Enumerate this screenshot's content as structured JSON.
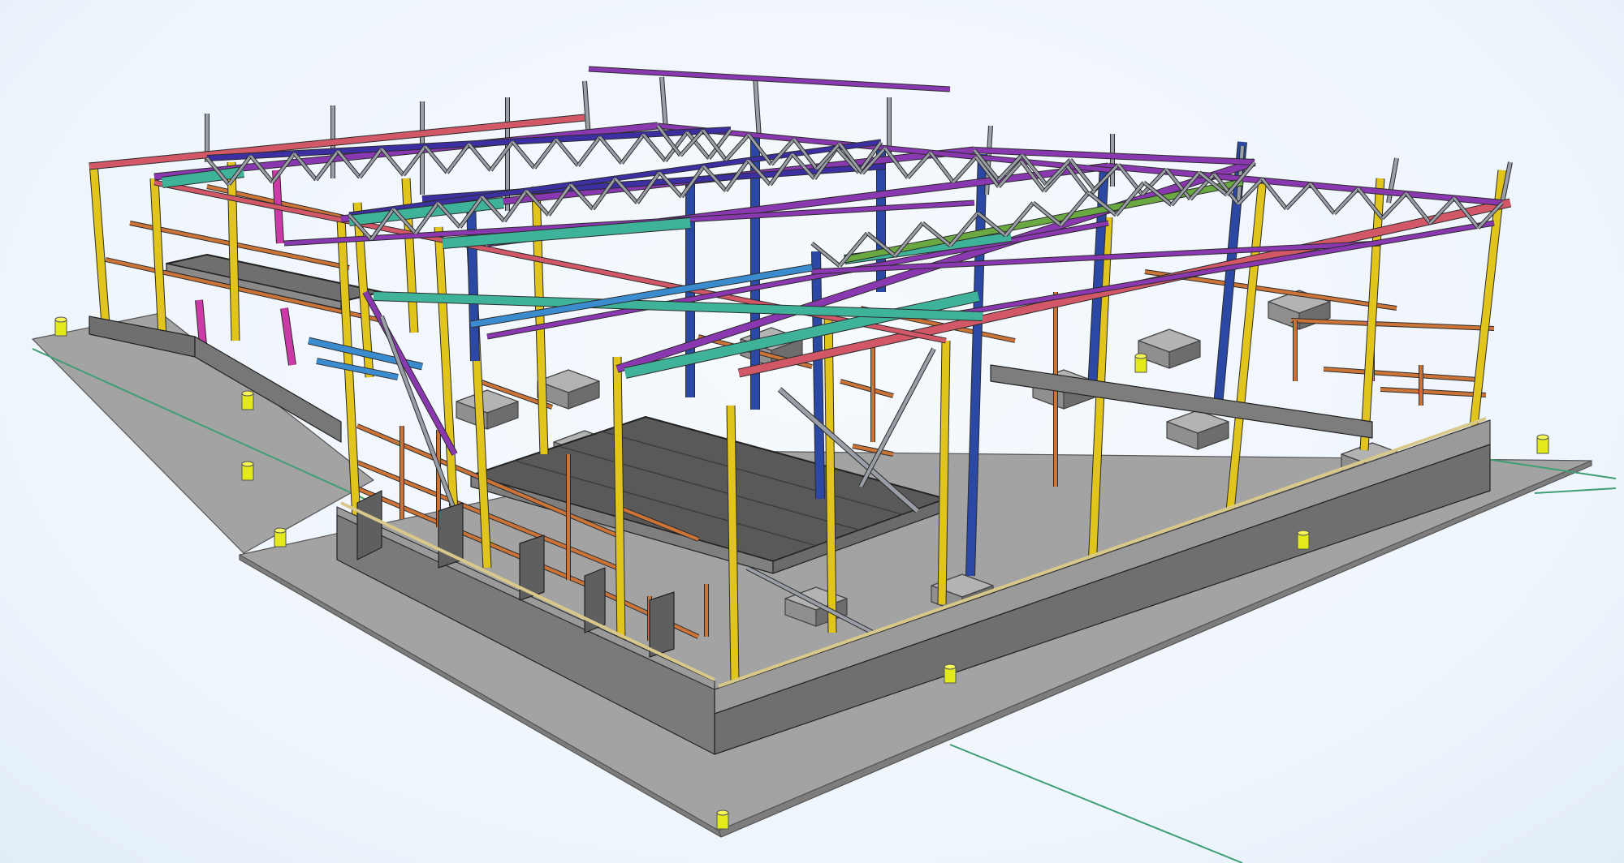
{
  "viewport": {
    "background_color": "#eef5fc"
  },
  "model": {
    "palette": {
      "foundation_top": "#a3a3a3",
      "foundation_side": "#7d7d7d",
      "wall_top": "#9a9a9a",
      "wall_front": "#6f6f6f",
      "wall_inner": "#d8c98a",
      "column_yellow": "#e2c51c",
      "column_blue": "#2a48a4",
      "girder_red": "#d25868",
      "truss_purple": "#8a38b0",
      "chord_indigo": "#3b2fa2",
      "web_gray": "#9a9ea6",
      "beam_teal": "#3fb39a",
      "beam_cyan": "#3a8ccf",
      "magenta": "#cc3aa8",
      "girt_orange": "#cc7438",
      "slab_dark": "#595959",
      "slab_light": "#7f7f7f",
      "grid_green": "#3e9e74",
      "anchor_yellow": "#e4ea1a",
      "footing_gray": "#8f8f8f"
    }
  }
}
